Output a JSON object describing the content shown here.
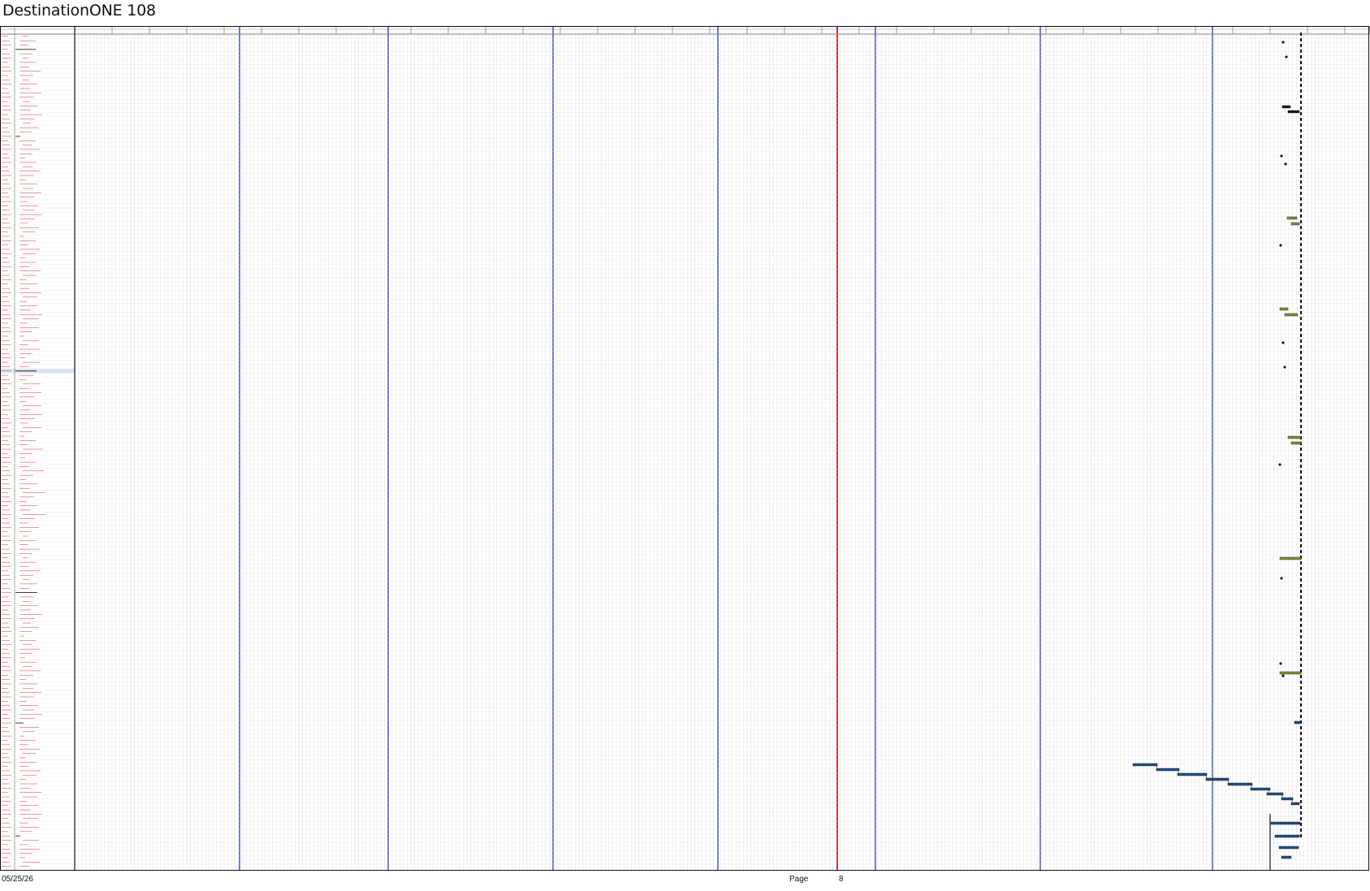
{
  "document": {
    "title": "DestinationONE 108",
    "footer": {
      "date": "05/25/26",
      "page_label": "Page",
      "page_number": "8"
    }
  },
  "table": {
    "column_headers": [
      "",
      ""
    ],
    "section_labels": [
      "Implementation",
      "Electrical",
      "Plumbing",
      "Finishes",
      "Closeout"
    ]
  },
  "colors": {
    "grid": "#c9c9c9",
    "row_line": "#e4e4e4",
    "quarter_line": "#2a3bb5",
    "today_line": "#d21a1a",
    "task_text": "#c0392b",
    "bar_dark": "#1a1a1a",
    "bar_blue": "#1f4e8c",
    "bar_olive": "#8a8a3a",
    "milestone": "#111111",
    "highlight_row": "#d9e4f5"
  },
  "icons": [
    "milestone-icon"
  ]
}
